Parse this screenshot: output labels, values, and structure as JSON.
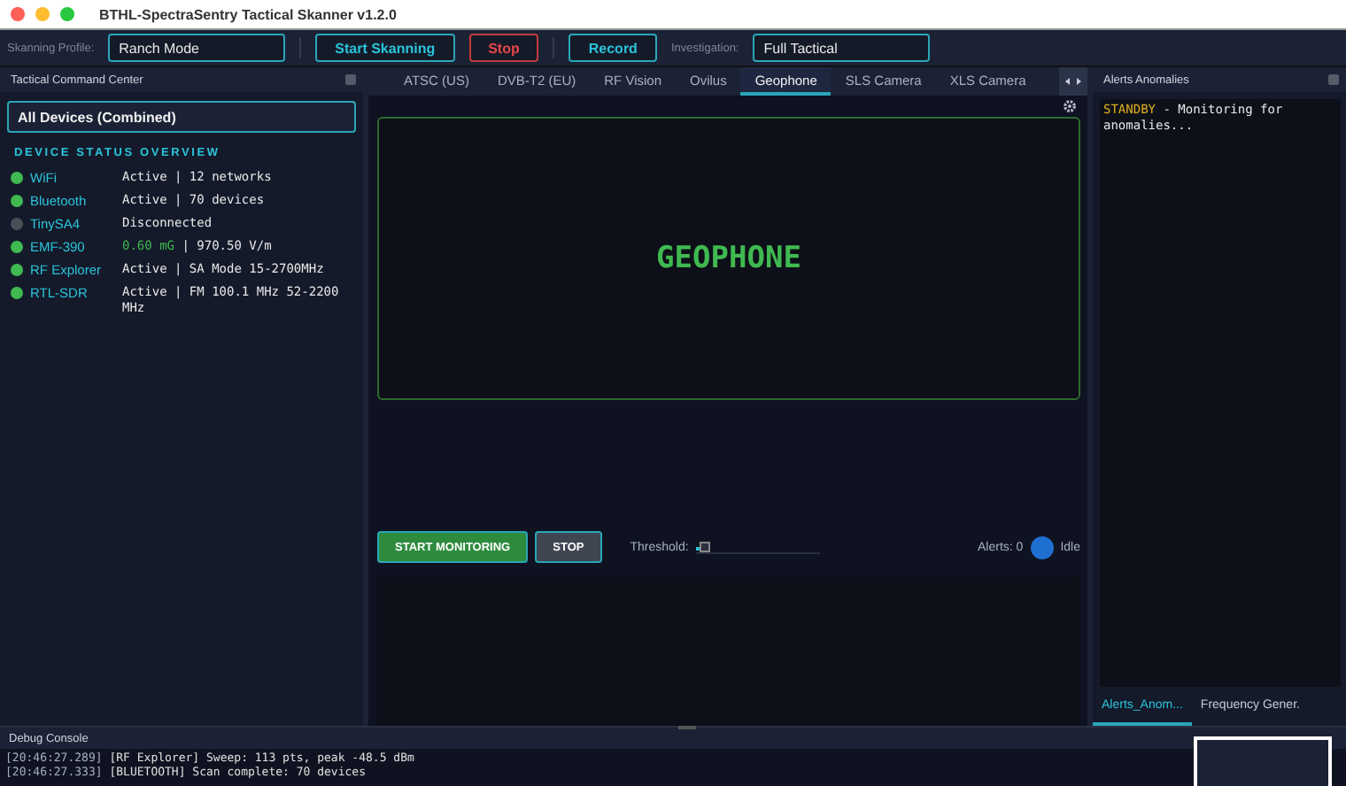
{
  "window": {
    "title": "BTHL-SpectraSentry Tactical Skanner v1.2.0"
  },
  "toolbar": {
    "profile_label": "Skanning Profile:",
    "profile_value": "Ranch Mode",
    "start_button": "Start Skanning",
    "stop_button": "Stop",
    "record_button": "Record",
    "investigation_label": "Investigation:",
    "investigation_value": "Full Tactical"
  },
  "left_panel": {
    "title": "Tactical Command Center",
    "device_select": "All Devices (Combined)",
    "section_title": "DEVICE STATUS OVERVIEW",
    "devices": [
      {
        "name": "WiFi",
        "status": "Active | 12 networks",
        "color": "#3fb950"
      },
      {
        "name": "Bluetooth",
        "status": "Active | 70 devices",
        "color": "#3fb950"
      },
      {
        "name": "TinySA4",
        "status": "Disconnected",
        "color": "#4a4f57"
      },
      {
        "name": "EMF-390",
        "highlight": "0.60 mG",
        "status": "| 970.50 V/m",
        "color": "#3fb950"
      },
      {
        "name": "RF Explorer",
        "status": "Active | SA Mode  15-2700MHz",
        "color": "#3fb950"
      },
      {
        "name": "RTL-SDR",
        "status": "Active | FM 100.1 MHz  52-2200 MHz",
        "color": "#3fb950"
      }
    ]
  },
  "tabs": [
    {
      "label": "ATSC (US)",
      "selected": false
    },
    {
      "label": "DVB-T2 (EU)",
      "selected": false
    },
    {
      "label": "RF Vision",
      "selected": false
    },
    {
      "label": "Ovilus",
      "selected": false
    },
    {
      "label": "Geophone",
      "selected": true
    },
    {
      "label": "SLS Camera",
      "selected": false
    },
    {
      "label": "XLS Camera",
      "selected": false
    }
  ],
  "geophone": {
    "display_text": "GEOPHONE",
    "start_button": "START MONITORING",
    "stop_button": "STOP",
    "threshold_label": "Threshold:",
    "threshold": {
      "level": 0.04
    },
    "alerts": "Alerts: 0",
    "state": "Idle"
  },
  "right_panel": {
    "title": "Alerts Anomalies",
    "log_tag": "STANDBY",
    "log_text": " - Monitoring for anomalies...",
    "tabs": [
      {
        "label": "Alerts_Anom...",
        "selected": true
      },
      {
        "label": "Frequency Gener.",
        "selected": false
      }
    ]
  },
  "debug_console": {
    "title": "Debug Console",
    "lines": [
      {
        "time": "[20:46:27.289]",
        "text": "[RF Explorer] Sweep: 113 pts, peak -48.5 dBm"
      },
      {
        "time": "[20:46:27.333]",
        "text": "[BLUETOOTH] Scan complete: 70 devices"
      }
    ]
  }
}
